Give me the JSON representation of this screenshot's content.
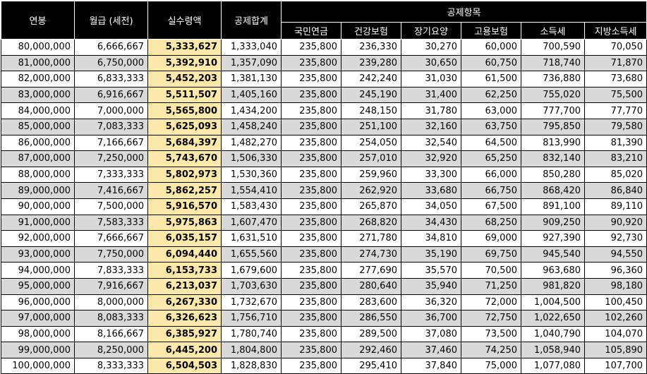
{
  "headers": {
    "annual": "연봉",
    "monthly": "월급 (세전)",
    "net": "실수령액",
    "total": "공제합계",
    "group": "공제항목",
    "items": [
      "국민연금",
      "건강보험",
      "장기요양",
      "고용보험",
      "소득세",
      "지방소득세"
    ]
  },
  "rows": [
    [
      "80,000,000",
      "6,666,667",
      "5,333,627",
      "1,333,040",
      "235,800",
      "236,330",
      "30,270",
      "60,000",
      "700,590",
      "70,050"
    ],
    [
      "81,000,000",
      "6,750,000",
      "5,392,910",
      "1,357,090",
      "235,800",
      "239,280",
      "30,650",
      "60,750",
      "718,740",
      "71,870"
    ],
    [
      "82,000,000",
      "6,833,333",
      "5,452,203",
      "1,381,130",
      "235,800",
      "242,240",
      "31,030",
      "61,500",
      "736,880",
      "73,680"
    ],
    [
      "83,000,000",
      "6,916,667",
      "5,511,507",
      "1,405,160",
      "235,800",
      "245,190",
      "31,400",
      "62,250",
      "755,020",
      "75,500"
    ],
    [
      "84,000,000",
      "7,000,000",
      "5,565,800",
      "1,434,200",
      "235,800",
      "248,150",
      "31,780",
      "63,000",
      "777,700",
      "77,770"
    ],
    [
      "85,000,000",
      "7,083,333",
      "5,625,093",
      "1,458,240",
      "235,800",
      "251,100",
      "32,160",
      "63,750",
      "795,850",
      "79,580"
    ],
    [
      "86,000,000",
      "7,166,667",
      "5,684,397",
      "1,482,270",
      "235,800",
      "254,050",
      "32,540",
      "64,500",
      "813,990",
      "81,390"
    ],
    [
      "87,000,000",
      "7,250,000",
      "5,743,670",
      "1,506,330",
      "235,800",
      "257,010",
      "32,920",
      "65,250",
      "832,140",
      "83,210"
    ],
    [
      "88,000,000",
      "7,333,333",
      "5,802,973",
      "1,530,360",
      "235,800",
      "259,960",
      "33,300",
      "66,000",
      "850,280",
      "85,020"
    ],
    [
      "89,000,000",
      "7,416,667",
      "5,862,257",
      "1,554,410",
      "235,800",
      "262,920",
      "33,680",
      "66,750",
      "868,420",
      "86,840"
    ],
    [
      "90,000,000",
      "7,500,000",
      "5,916,570",
      "1,583,430",
      "235,800",
      "265,870",
      "34,050",
      "67,500",
      "891,100",
      "89,110"
    ],
    [
      "91,000,000",
      "7,583,333",
      "5,975,863",
      "1,607,470",
      "235,800",
      "268,820",
      "34,430",
      "68,250",
      "909,250",
      "90,920"
    ],
    [
      "92,000,000",
      "7,666,667",
      "6,035,157",
      "1,631,510",
      "235,800",
      "271,780",
      "34,810",
      "69,000",
      "927,390",
      "92,730"
    ],
    [
      "93,000,000",
      "7,750,000",
      "6,094,440",
      "1,655,560",
      "235,800",
      "274,730",
      "35,190",
      "69,750",
      "945,540",
      "94,550"
    ],
    [
      "94,000,000",
      "7,833,333",
      "6,153,733",
      "1,679,600",
      "235,800",
      "277,690",
      "35,570",
      "70,500",
      "963,680",
      "96,360"
    ],
    [
      "95,000,000",
      "7,916,667",
      "6,213,037",
      "1,703,630",
      "235,800",
      "280,640",
      "35,940",
      "71,250",
      "981,820",
      "98,180"
    ],
    [
      "96,000,000",
      "8,000,000",
      "6,267,330",
      "1,732,670",
      "235,800",
      "283,600",
      "36,320",
      "72,000",
      "1,004,500",
      "100,450"
    ],
    [
      "97,000,000",
      "8,083,333",
      "6,326,623",
      "1,756,710",
      "235,800",
      "286,550",
      "36,700",
      "72,750",
      "1,022,650",
      "102,260"
    ],
    [
      "98,000,000",
      "8,166,667",
      "6,385,927",
      "1,780,740",
      "235,800",
      "289,500",
      "37,080",
      "73,500",
      "1,040,790",
      "104,070"
    ],
    [
      "99,000,000",
      "8,250,000",
      "6,445,200",
      "1,804,800",
      "235,800",
      "292,460",
      "37,460",
      "74,250",
      "1,058,940",
      "105,890"
    ],
    [
      "100,000,000",
      "8,333,333",
      "6,504,503",
      "1,828,830",
      "235,800",
      "295,410",
      "37,840",
      "75,000",
      "1,077,080",
      "107,700"
    ]
  ]
}
